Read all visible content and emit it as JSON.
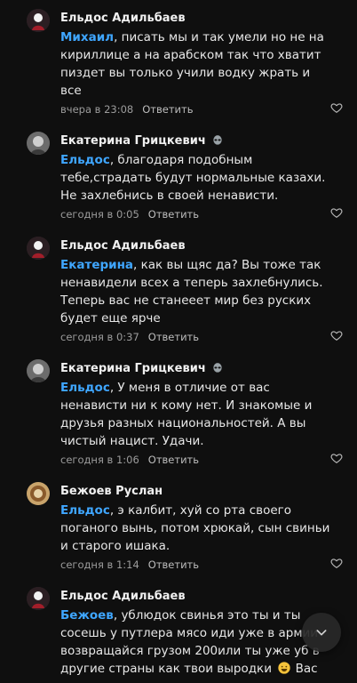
{
  "comments": [
    {
      "author": "Ельдос Адильбаев",
      "mention": "Михаил",
      "text": ", писать мы и так умели но не на кириллице а на арабском так что хватит пиздет вы только учили водку жрать и все",
      "time": "вчера в 23:08",
      "reply_label": "Ответить"
    },
    {
      "author": "Екатерина Грицкевич",
      "mention": "Ельдос",
      "text": ", благодаря подобным тебе,страдать будут нормальные казахи. Не захлебнись в своей ненависти.",
      "time": "сегодня в 0:05",
      "reply_label": "Ответить"
    },
    {
      "author": "Ельдос Адильбаев",
      "mention": "Екатерина",
      "text": ", как вы щяс да? Вы тоже так ненавидели всех а теперь захлебнулись. Теперь вас не станееет мир без руских будет еще ярче",
      "time": "сегодня в 0:37",
      "reply_label": "Ответить"
    },
    {
      "author": "Екатерина Грицкевич",
      "mention": "Ельдос",
      "text": ", У меня в отличие от вас ненависти ни к кому нет. И знакомые и друзья разных национальностей. А вы чистый нацист. Удачи.",
      "time": "сегодня в 1:06",
      "reply_label": "Ответить"
    },
    {
      "author": "Бежоев Руслан",
      "mention": "Ельдос",
      "text": ", э калбит, хуй со рта своего поганого вынь, потом хрюкай, сын свиньи и старого ишака.",
      "time": "сегодня в 1:14",
      "reply_label": "Ответить"
    },
    {
      "author": "Ельдос Адильбаев",
      "mention": "Бежоев",
      "text": ", ублюдок свинья это ты и ты сосешь у путлера мясо иди уже в армии возвращайся грузом 200или ты уже уб в другие страны как твои выродки",
      "trailing": " Вас"
    }
  ],
  "icons": {
    "like": "heart-icon",
    "badge": "alien-icon",
    "scroll": "chevron-down-icon",
    "emoji": "grinning-face-icon"
  },
  "colors": {
    "background": "#0f0f0f",
    "mention": "#3fa6ff",
    "meta": "#9c9c9c"
  }
}
